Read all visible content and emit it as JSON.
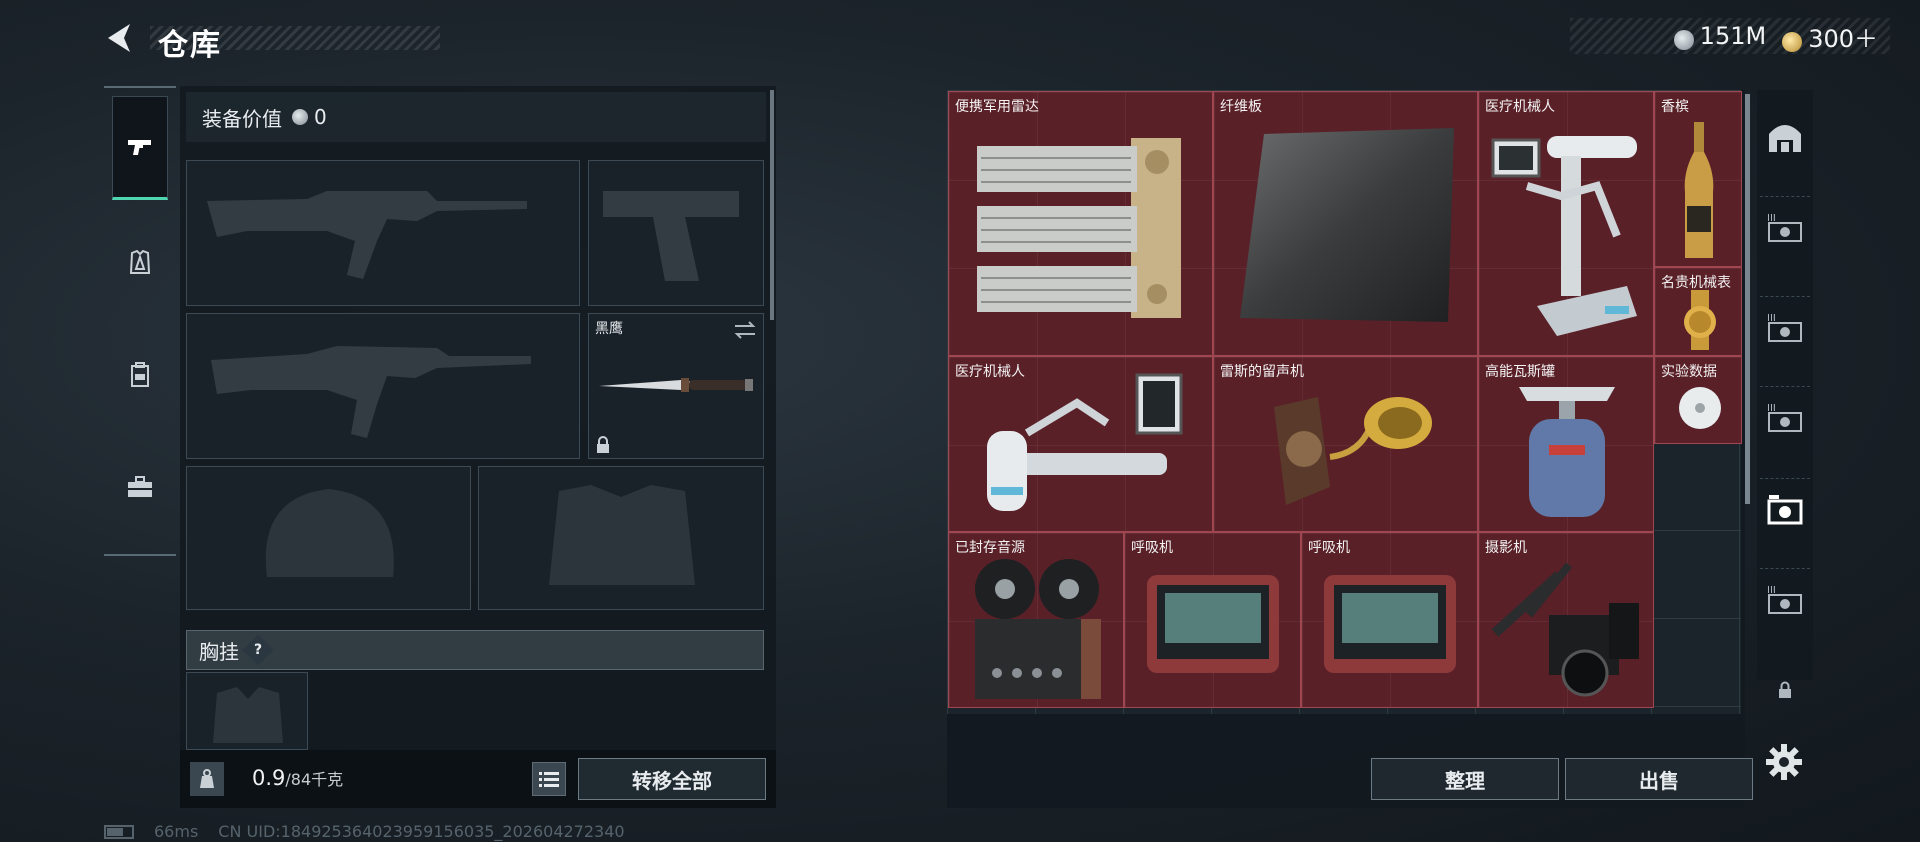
{
  "header": {
    "title": "仓库",
    "currencies": [
      {
        "icon": "silver-coin-icon",
        "value": "151M"
      },
      {
        "icon": "gold-coin-icon",
        "value": "300＋"
      }
    ]
  },
  "left_tabs": [
    {
      "icon": "pistol-icon",
      "active": true
    },
    {
      "icon": "armor-icon",
      "active": false
    },
    {
      "icon": "backpack-icon",
      "active": false
    },
    {
      "icon": "toolbox-icon",
      "active": false
    }
  ],
  "equipment": {
    "value_label": "装备价值",
    "value": "0",
    "melee_slot": {
      "name": "黑鹰",
      "locked": true
    },
    "chest_rig_label": "胸挂",
    "help": "?"
  },
  "bottom_left": {
    "weight_current": "0.9",
    "weight_max": "/84千克",
    "transfer_all": "转移全部"
  },
  "stash": {
    "items": [
      {
        "name": "便携军用雷达"
      },
      {
        "name": "纤维板"
      },
      {
        "name": "医疗机械人"
      },
      {
        "name": "香槟"
      },
      {
        "name": "名贵机械表"
      },
      {
        "name": "医疗机械人"
      },
      {
        "name": "雷斯的留声机"
      },
      {
        "name": "高能瓦斯罐"
      },
      {
        "name": "实验数据"
      },
      {
        "name": "已封存音源"
      },
      {
        "name": "呼吸机"
      },
      {
        "name": "呼吸机"
      },
      {
        "name": "摄影机"
      }
    ],
    "organize": "整理",
    "sell": "出售"
  },
  "right_rail": [
    {
      "icon": "vault-icon"
    },
    {
      "icon": "container-tier3-icon"
    },
    {
      "icon": "container-tier3-icon"
    },
    {
      "icon": "container-tier3-icon"
    },
    {
      "icon": "container-selected-icon"
    },
    {
      "icon": "container-tier3-icon"
    },
    {
      "icon": "lock-icon"
    }
  ],
  "status": {
    "ping": "66ms",
    "uid": "CN UID:184925364023959156035_202604272340"
  },
  "colors": {
    "accent": "#4fd6b0",
    "item_bg": "#5f2128",
    "panel_bg": "#12191f"
  }
}
